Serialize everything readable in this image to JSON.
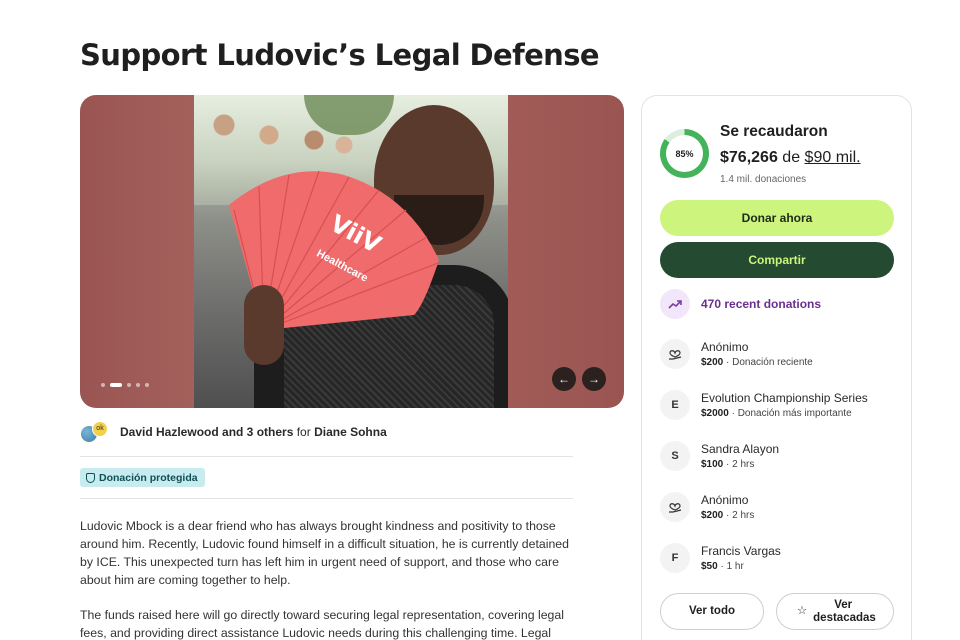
{
  "page": {
    "title": "Support Ludovic’s Legal Defense"
  },
  "gallery": {
    "fan_text": "ViiV",
    "fan_subtext": "Healthcare",
    "slide_count": 5,
    "active_slide": 2,
    "prev_label": "←",
    "next_label": "→"
  },
  "organizer": {
    "names": "David Hazlewood and 3 others",
    "for_word": "for",
    "beneficiary": "Diane Sohna",
    "avatar2_text": "ok"
  },
  "badge": {
    "label": "Donación protegida"
  },
  "story": {
    "paragraph1": "Ludovic Mbock is a dear friend who has always brought kindness and positivity to those around him. Recently, Ludovic found himself in a difficult situation, he is currently detained by ICE. This unexpected turn has left him in urgent need of support, and those who care about him are coming together to help.",
    "paragraph2": "The funds raised here will go directly toward securing legal representation, covering legal fees, and providing direct assistance Ludovic needs during this challenging time. Legal"
  },
  "sidebar": {
    "progress_percent": 85,
    "progress_label": "85%",
    "raised_title": "Se recaudaron",
    "raised_amount": "$76,266",
    "raised_of": "de",
    "goal": "$90 mil.",
    "donation_count": "1.4 mil. donaciones",
    "donate_button": "Donar ahora",
    "share_button": "Compartir",
    "recent_label": "470 recent donations",
    "donors": [
      {
        "name": "Anónimo",
        "amount": "$200",
        "detail": " · Donación reciente",
        "initial": "",
        "icon": "heart-hand-icon"
      },
      {
        "name": "Evolution Championship Series",
        "amount": "$2000",
        "detail": " · Donación más importante",
        "initial": "E",
        "icon": ""
      },
      {
        "name": "Sandra Alayon",
        "amount": "$100",
        "detail": " · 2 hrs",
        "initial": "S",
        "icon": ""
      },
      {
        "name": "Anónimo",
        "amount": "$200",
        "detail": " · 2 hrs",
        "initial": "",
        "icon": "heart-hand-icon"
      },
      {
        "name": "Francis Vargas",
        "amount": "$50",
        "detail": " · 1 hr",
        "initial": "F",
        "icon": ""
      }
    ],
    "see_all_button": "Ver todo",
    "see_top_button": "Ver destacadas"
  },
  "colors": {
    "accent_green": "#cdf47c",
    "dark_green": "#244a31",
    "progress_green": "#44b35a",
    "recent_purple": "#6b2f8f",
    "badge_teal": "#c7ebef"
  }
}
